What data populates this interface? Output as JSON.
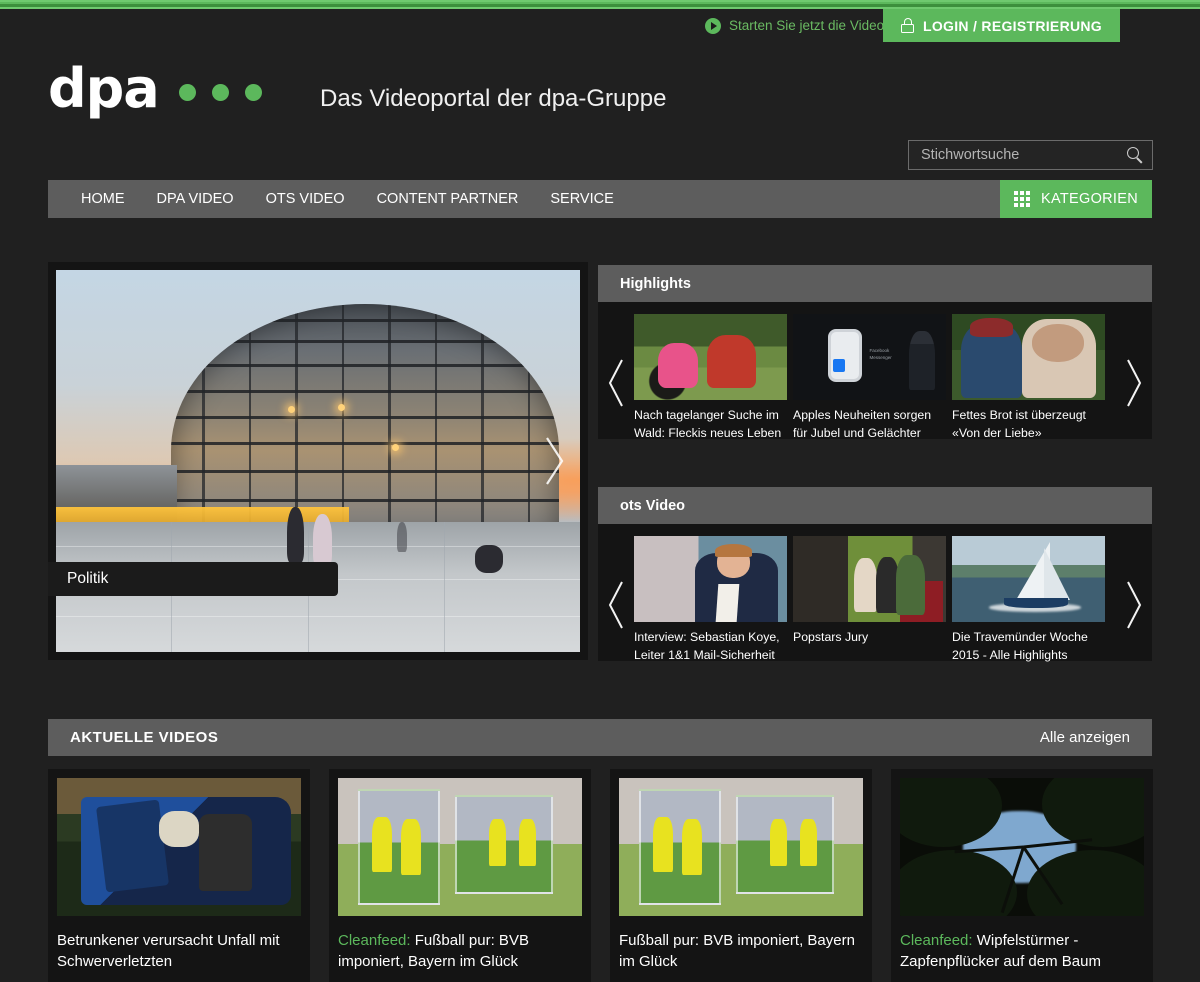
{
  "topbar": {
    "videotour_label": "Starten Sie jetzt die Videotour",
    "login_label": "LOGIN / REGISTRIERUNG",
    "accent_color": "#5cb85c"
  },
  "brand": {
    "logo_text": "dpa",
    "tagline": "Das Videoportal der dpa-Gruppe",
    "dots": 3
  },
  "search": {
    "placeholder": "Stichwortsuche",
    "value": ""
  },
  "nav": {
    "items": [
      {
        "label": "HOME"
      },
      {
        "label": "DPA VIDEO"
      },
      {
        "label": "OTS VIDEO"
      },
      {
        "label": "CONTENT PARTNER"
      },
      {
        "label": "SERVICE"
      }
    ],
    "categories_label": "KATEGORIEN"
  },
  "hero": {
    "category_label": "Politik",
    "image_alt": "Reichstag Kuppel bei Sonnenuntergang"
  },
  "panels": [
    {
      "title": "Highlights",
      "cards": [
        {
          "title": "Nach tagelanger Suche im Wald: Fleckis neues Leben",
          "art": "dog"
        },
        {
          "title": "Apples Neuheiten sorgen für Jubel und Gelächter",
          "art": "watch"
        },
        {
          "title": "Fettes Brot ist überzeugt «Von der Liebe»",
          "art": "brot"
        }
      ]
    },
    {
      "title": "ots Video",
      "cards": [
        {
          "title": "Interview: Sebastian Koye, Leiter 1&1 Mail-Sicherheit",
          "art": "interview"
        },
        {
          "title": "Popstars Jury",
          "art": "pop"
        },
        {
          "title": "Die Travemünder Woche 2015 - Alle Highlights",
          "art": "sail"
        }
      ]
    }
  ],
  "aktuelle": {
    "heading": "AKTUELLE VIDEOS",
    "show_all_label": "Alle anzeigen",
    "items": [
      {
        "tag": "",
        "title": "Betrunkener verursacht Unfall mit Schwerverletzten",
        "art": "crash"
      },
      {
        "tag": "Cleanfeed:",
        "title": "Fußball pur: BVB imponiert, Bayern im Glück",
        "art": "foot"
      },
      {
        "tag": "",
        "title": "Fußball pur: BVB imponiert, Bayern im Glück",
        "art": "foot"
      },
      {
        "tag": "Cleanfeed:",
        "title": "Wipfelstürmer - Zapfenpflücker auf dem Baum",
        "art": "trees"
      }
    ]
  }
}
